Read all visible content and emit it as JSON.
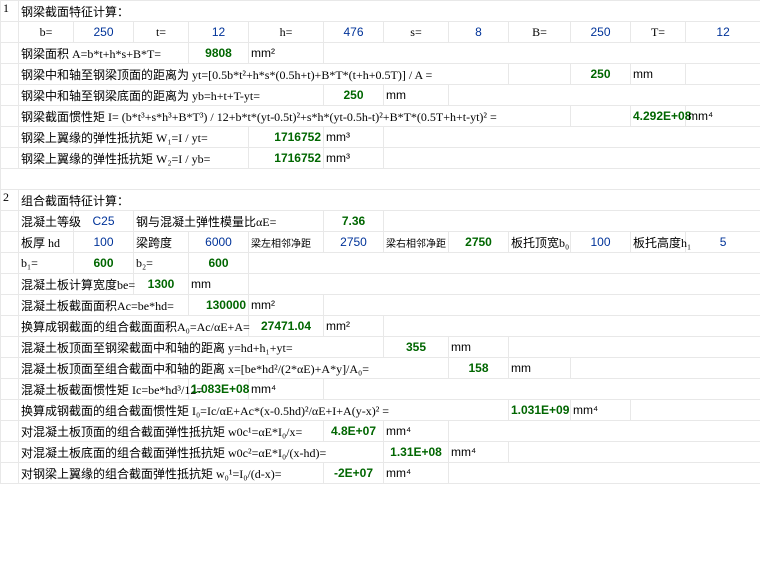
{
  "s1": {
    "title": "钢梁截面特征计算：",
    "p": {
      "b_l": "b=",
      "b_v": "250",
      "t_l": "t=",
      "t_v": "12",
      "h_l": "h=",
      "h_v": "476",
      "s_l": "s=",
      "s_v": "8",
      "B_l": "B=",
      "B_v": "250",
      "T_l": "T=",
      "T_v": "12"
    },
    "r": [
      {
        "l": "钢梁面积 A=b*t+h*s+B*T=",
        "v": "9808",
        "u": "mm²"
      },
      {
        "l": "钢梁中和轴至钢梁顶面的距离为 yt=[0.5b*t²+h*s*(0.5h+t)+B*T*(t+h+0.5T)] / A =",
        "v": "250",
        "u": "mm"
      },
      {
        "l": "钢梁中和轴至钢梁底面的距离为 yb=h+t+T-yt=",
        "v": "250",
        "u": "mm"
      },
      {
        "l": "钢梁截面惯性矩 I= (b*t³+s*h³+B*T³) / 12+b*t*(yt-0.5t)²+s*h*(yt-0.5h-t)²+B*T*(0.5T+h+t-yt)² =",
        "v": "4.292E+08",
        "u": "mm⁴"
      },
      {
        "l": "钢梁上翼缘的弹性抵抗矩 W₁=I / yt=",
        "v": "1716752",
        "u": "mm³"
      },
      {
        "l": "钢梁上翼缘的弹性抵抗矩 W₂=I / yb=",
        "v": "1716752",
        "u": "mm³"
      }
    ]
  },
  "s2": {
    "title": "组合截面特征计算：",
    "r1": {
      "l1": "混凝土等级",
      "v1": "C25",
      "l2": "钢与混凝土弹性模量比αE=",
      "v2": "7.36"
    },
    "r2": {
      "l1": "板厚 hd",
      "v1": "100",
      "l2": "梁跨度",
      "v2": "6000",
      "l3": "梁左相邻净距",
      "v3": "2750",
      "l4": "梁右相邻净距",
      "v4": "2750",
      "l5": "板托顶宽b₀",
      "v5": "100",
      "l6": "板托高度h₁",
      "v6": "5"
    },
    "r3": {
      "l1": "b₁=",
      "v1": "600",
      "l2": "b₂=",
      "v2": "600"
    },
    "rows": [
      {
        "l": "混凝土板计算宽度be=",
        "v": "1300",
        "u": "mm"
      },
      {
        "l": "混凝土板截面面积Ac=be*hd=",
        "v": "130000",
        "u": "mm²"
      },
      {
        "l": "换算成钢截面的组合截面面积A₀=Ac/αE+A=",
        "v": "27471.04",
        "u": "mm²"
      },
      {
        "l": "混凝土板顶面至钢梁截面中和轴的距离 y=hd+h₁+yt=",
        "v": "355",
        "u": "mm"
      },
      {
        "l": "混凝土板顶面至组合截面中和轴的距离 x=[be*hd²/(2*αE)+A*y]/A₀=",
        "v": "158",
        "u": "mm"
      },
      {
        "l": "混凝土板截面惯性矩 Ic=be*hd³/12=",
        "v": "1.083E+08",
        "u": "mm⁴"
      },
      {
        "l": "换算成钢截面的组合截面惯性矩 I₀=Ic/αE+Ac*(x-0.5hd)²/αE+I+A(y-x)² =",
        "v": "1.031E+09",
        "u": "mm⁴"
      },
      {
        "l": "对混凝土板顶面的组合截面弹性抵抗矩 w0c¹=αE*I₀/x=",
        "v": "4.8E+07",
        "u": "mm⁴"
      },
      {
        "l": "对混凝土板底面的组合截面弹性抵抗矩 w0c²=αE*I₀/(x-hd)=",
        "v": "1.31E+08",
        "u": "mm⁴"
      },
      {
        "l": "对钢梁上翼缘的组合截面弹性抵抗矩 w₀¹=I₀/(d-x)=",
        "v": "-2E+07",
        "u": "mm⁴"
      }
    ]
  }
}
